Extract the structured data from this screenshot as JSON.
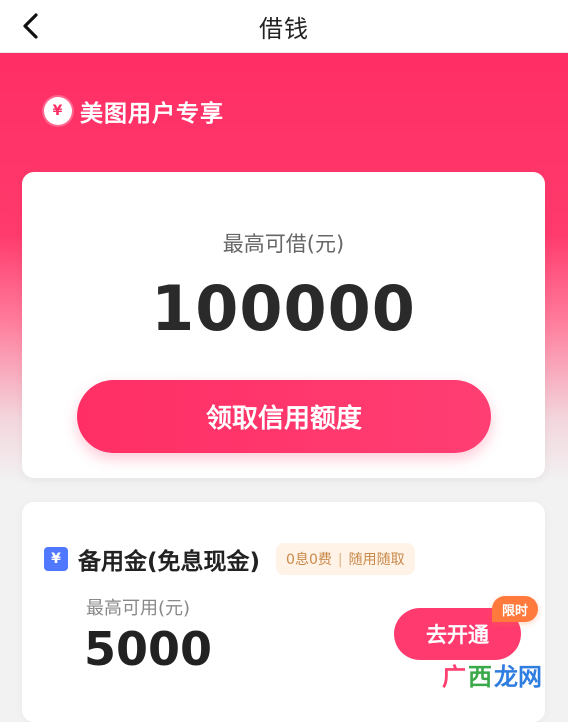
{
  "header": {
    "title": "借钱"
  },
  "brand": {
    "label": "美图用户专享",
    "icon_glyph": "¥"
  },
  "main_card": {
    "limit_label": "最高可借(元)",
    "limit_amount": "100000",
    "cta_label": "领取信用额度"
  },
  "fund_card": {
    "title": "备用金(免息现金)",
    "tag_part_1": "0息0费",
    "tag_part_2": "随用随取",
    "available_label": "最高可用(元)",
    "available_amount": "5000",
    "open_button_label": "去开通",
    "limited_badge": "限时",
    "icon_glyph": "¥"
  },
  "watermark": {
    "part_1": "广",
    "part_2": "西",
    "part_3": "龙网"
  },
  "colors": {
    "accent_pink": "#ff2e65",
    "button_pink": "#ff3a6e",
    "badge_orange": "#ff7a3c",
    "tag_bg": "#fff2e6",
    "tag_text": "#c98a4b",
    "blue_badge": "#4f78ff"
  },
  "icons": {
    "back": "chevron-left-icon",
    "brand": "yen-coin-icon",
    "fund": "yen-badge-icon"
  }
}
